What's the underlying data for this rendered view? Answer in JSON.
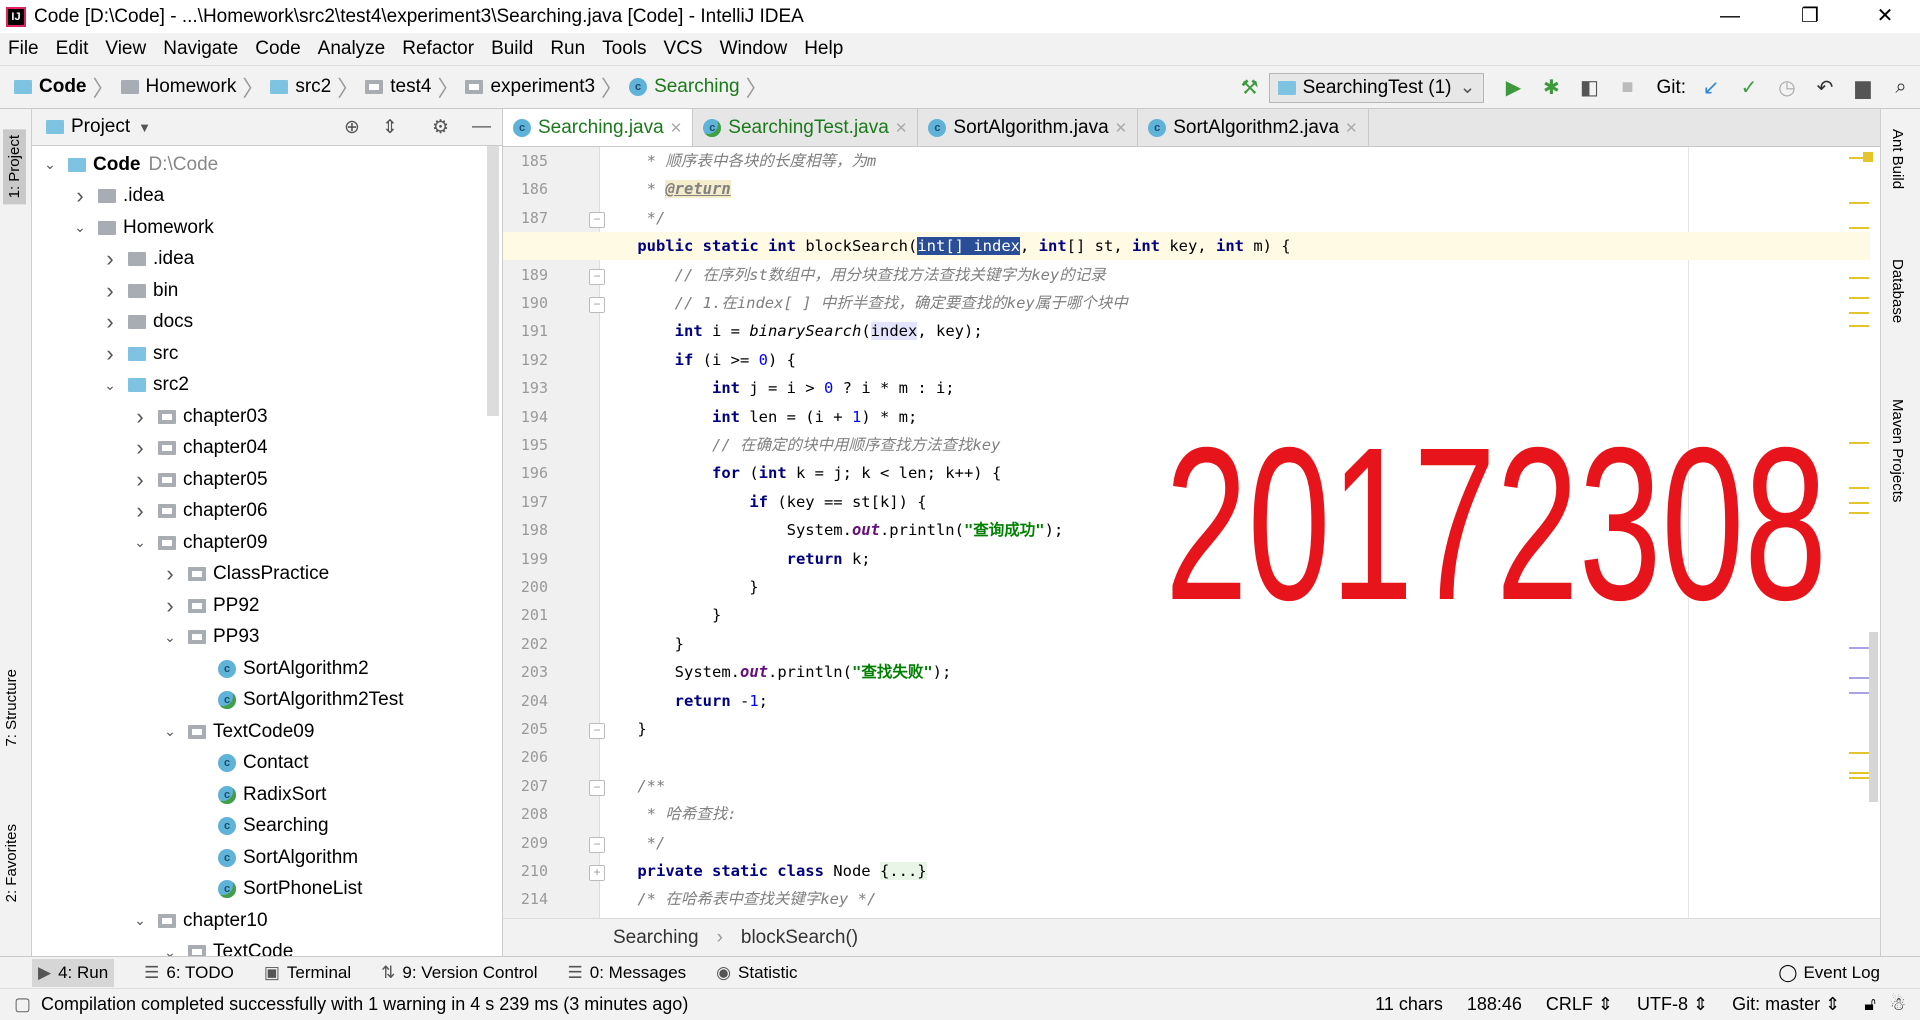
{
  "window": {
    "title": "Code [D:\\Code] - ...\\Homework\\src2\\test4\\experiment3\\Searching.java [Code] - IntelliJ IDEA",
    "minimize": "—",
    "restore": "❐",
    "close": "✕"
  },
  "menu": [
    "File",
    "Edit",
    "View",
    "Navigate",
    "Code",
    "Analyze",
    "Refactor",
    "Build",
    "Run",
    "Tools",
    "VCS",
    "Window",
    "Help"
  ],
  "breadcrumb": [
    {
      "label": "Code",
      "icon": "module-folder-icon"
    },
    {
      "label": "Homework",
      "icon": "folder-icon"
    },
    {
      "label": "src2",
      "icon": "source-folder-icon"
    },
    {
      "label": "test4",
      "icon": "package-icon"
    },
    {
      "label": "experiment3",
      "icon": "package-icon"
    },
    {
      "label": "Searching",
      "icon": "class-icon"
    }
  ],
  "toolbar": {
    "run_config": "SearchingTest (1)",
    "git_label": "Git:"
  },
  "left_stripe": {
    "project": "1: Project",
    "structure": "7: Structure",
    "favorites": "2: Favorites"
  },
  "right_stripe": {
    "ant": "Ant Build",
    "database": "Database",
    "maven": "Maven Projects"
  },
  "project": {
    "title": "Project",
    "tree": [
      {
        "label": "Code",
        "extra": "D:\\Code",
        "level": 0,
        "arrow": "open",
        "icon": "module",
        "bold": true
      },
      {
        "label": ".idea",
        "level": 1,
        "arrow": "closed",
        "icon": "folder"
      },
      {
        "label": "Homework",
        "level": 1,
        "arrow": "open",
        "icon": "folder"
      },
      {
        "label": ".idea",
        "level": 2,
        "arrow": "closed",
        "icon": "folder"
      },
      {
        "label": "bin",
        "level": 2,
        "arrow": "closed",
        "icon": "folder"
      },
      {
        "label": "docs",
        "level": 2,
        "arrow": "closed",
        "icon": "folder"
      },
      {
        "label": "src",
        "level": 2,
        "arrow": "closed",
        "icon": "srcfolder"
      },
      {
        "label": "src2",
        "level": 2,
        "arrow": "open",
        "icon": "srcfolder"
      },
      {
        "label": "chapter03",
        "level": 3,
        "arrow": "closed",
        "icon": "package"
      },
      {
        "label": "chapter04",
        "level": 3,
        "arrow": "closed",
        "icon": "package"
      },
      {
        "label": "chapter05",
        "level": 3,
        "arrow": "closed",
        "icon": "package"
      },
      {
        "label": "chapter06",
        "level": 3,
        "arrow": "closed",
        "icon": "package"
      },
      {
        "label": "chapter09",
        "level": 3,
        "arrow": "open",
        "icon": "package"
      },
      {
        "label": "ClassPractice",
        "level": 4,
        "arrow": "closed",
        "icon": "package"
      },
      {
        "label": "PP92",
        "level": 4,
        "arrow": "closed",
        "icon": "package"
      },
      {
        "label": "PP93",
        "level": 4,
        "arrow": "open",
        "icon": "package"
      },
      {
        "label": "SortAlgorithm2",
        "level": 5,
        "icon": "class"
      },
      {
        "label": "SortAlgorithm2Test",
        "level": 5,
        "icon": "testclass"
      },
      {
        "label": "TextCode09",
        "level": 4,
        "arrow": "open",
        "icon": "package"
      },
      {
        "label": "Contact",
        "level": 5,
        "icon": "class"
      },
      {
        "label": "RadixSort",
        "level": 5,
        "icon": "testclass"
      },
      {
        "label": "Searching",
        "level": 5,
        "icon": "class"
      },
      {
        "label": "SortAlgorithm",
        "level": 5,
        "icon": "class"
      },
      {
        "label": "SortPhoneList",
        "level": 5,
        "icon": "testclass"
      },
      {
        "label": "chapter10",
        "level": 3,
        "arrow": "open",
        "icon": "package"
      },
      {
        "label": "TextCode",
        "level": 4,
        "arrow": "open",
        "icon": "package"
      }
    ]
  },
  "tabs": [
    {
      "label": "Searching.java",
      "active": true,
      "icon": "class"
    },
    {
      "label": "SearchingTest.java",
      "icon": "testclass"
    },
    {
      "label": "SortAlgorithm.java",
      "icon": "class"
    },
    {
      "label": "SortAlgorithm2.java",
      "icon": "class"
    }
  ],
  "code": [
    {
      "n": "185",
      "s": [
        [
          "     * 顺序表中各块的长度相等，为m",
          "cm"
        ]
      ]
    },
    {
      "n": "186",
      "s": [
        [
          "     * ",
          "cm"
        ],
        [
          "@return",
          "tag"
        ]
      ]
    },
    {
      "n": "187",
      "fold": "-",
      "s": [
        [
          "     */",
          "cm"
        ]
      ]
    },
    {
      "n": "188",
      "fold": "-",
      "cur": true,
      "s": [
        [
          "    "
        ],
        [
          "public",
          "kw"
        ],
        [
          " "
        ],
        [
          "static int",
          "kw"
        ],
        [
          " blockSearch("
        ],
        [
          "int[] index",
          "sel"
        ],
        [
          ", "
        ],
        [
          "int",
          "kw"
        ],
        [
          "[] st, "
        ],
        [
          "int",
          "kw"
        ],
        [
          " key, "
        ],
        [
          "int",
          "kw"
        ],
        [
          " m) {"
        ]
      ]
    },
    {
      "n": "189",
      "fold": "-",
      "s": [
        [
          "        // 在序列st数组中，用分块查找方法查找关键字为key的记录",
          "cm"
        ]
      ]
    },
    {
      "n": "190",
      "fold": "-",
      "s": [
        [
          "        // 1.在index[ ] 中折半查找，确定要查找的key属于哪个块中",
          "cm"
        ]
      ]
    },
    {
      "n": "191",
      "s": [
        [
          "        "
        ],
        [
          "int",
          "kw"
        ],
        [
          " i = "
        ],
        [
          "binarySearch",
          "it"
        ],
        [
          "("
        ],
        [
          "index",
          "hl"
        ],
        [
          ", key);"
        ]
      ]
    },
    {
      "n": "192",
      "s": [
        [
          "        "
        ],
        [
          "if",
          "kw"
        ],
        [
          " (i >= "
        ],
        [
          "0",
          "num"
        ],
        [
          ") {"
        ]
      ]
    },
    {
      "n": "193",
      "s": [
        [
          "            "
        ],
        [
          "int",
          "kw"
        ],
        [
          " j = i > "
        ],
        [
          "0",
          "num"
        ],
        [
          " ? i * m : i;"
        ]
      ]
    },
    {
      "n": "194",
      "s": [
        [
          "            "
        ],
        [
          "int",
          "kw"
        ],
        [
          " len = (i + "
        ],
        [
          "1",
          "num"
        ],
        [
          ") * m;"
        ]
      ]
    },
    {
      "n": "195",
      "s": [
        [
          "            // 在确定的块中用顺序查找方法查找key",
          "cm"
        ]
      ]
    },
    {
      "n": "196",
      "s": [
        [
          "            "
        ],
        [
          "for",
          "kw"
        ],
        [
          " ("
        ],
        [
          "int",
          "kw"
        ],
        [
          " k = j; k < len; k++) {"
        ]
      ]
    },
    {
      "n": "197",
      "s": [
        [
          "                "
        ],
        [
          "if",
          "kw"
        ],
        [
          " (key == st[k]) {"
        ]
      ]
    },
    {
      "n": "198",
      "s": [
        [
          "                    System."
        ],
        [
          "out",
          "fld"
        ],
        [
          ".println("
        ],
        [
          "\"查询成功\"",
          "st"
        ],
        [
          ");"
        ]
      ]
    },
    {
      "n": "199",
      "s": [
        [
          "                    "
        ],
        [
          "return",
          "kw"
        ],
        [
          " k;"
        ]
      ]
    },
    {
      "n": "200",
      "s": [
        [
          "                }"
        ]
      ]
    },
    {
      "n": "201",
      "s": [
        [
          "            }"
        ]
      ]
    },
    {
      "n": "202",
      "s": [
        [
          "        }"
        ]
      ]
    },
    {
      "n": "203",
      "s": [
        [
          "        System."
        ],
        [
          "out",
          "fld"
        ],
        [
          ".println("
        ],
        [
          "\"查找失败\"",
          "st"
        ],
        [
          ");"
        ]
      ]
    },
    {
      "n": "204",
      "s": [
        [
          "        "
        ],
        [
          "return",
          "kw"
        ],
        [
          " -"
        ],
        [
          "1",
          "num"
        ],
        [
          ";"
        ]
      ]
    },
    {
      "n": "205",
      "fold": "-",
      "s": [
        [
          "    }"
        ]
      ]
    },
    {
      "n": "206",
      "s": [
        [
          ""
        ]
      ]
    },
    {
      "n": "207",
      "fold": "-",
      "s": [
        [
          "    /**",
          "cm"
        ]
      ]
    },
    {
      "n": "208",
      "s": [
        [
          "     * 哈希查找:",
          "cm"
        ]
      ]
    },
    {
      "n": "209",
      "fold": "-",
      "s": [
        [
          "     */",
          "cm"
        ]
      ]
    },
    {
      "n": "210",
      "fold": "+",
      "s": [
        [
          "    "
        ],
        [
          "private static class",
          "kw"
        ],
        [
          " Node "
        ],
        [
          "{...}",
          "fold-ph"
        ]
      ]
    },
    {
      "n": "214",
      "s": [
        [
          "    /* 在哈希表中查找关键字key */",
          "cm"
        ]
      ]
    }
  ],
  "watermark": "20172308",
  "editor_breadcrumb": {
    "class": "Searching",
    "method": "blockSearch()"
  },
  "tool_windows": [
    {
      "label": "4: Run",
      "icon": "run-icon"
    },
    {
      "label": "6: TODO",
      "icon": "todo-icon"
    },
    {
      "label": "Terminal",
      "icon": "terminal-icon"
    },
    {
      "label": "9: Version Control",
      "icon": "vcs-icon"
    },
    {
      "label": "0: Messages",
      "icon": "messages-icon"
    },
    {
      "label": "Statistic",
      "icon": "statistic-icon"
    }
  ],
  "event_log": "Event Log",
  "status": {
    "message": "Compilation completed successfully with 1 warning in 4 s 239 ms (3 minutes ago)",
    "chars": "11 chars",
    "position": "188:46",
    "line_sep": "CRLF ⇕",
    "encoding": "UTF-8 ⇕",
    "git": "Git: master ⇕"
  },
  "colors": {
    "keyword": "#000080",
    "comment": "#808080",
    "string": "#008000",
    "selection": "#2a4d97",
    "watermark": "#e8141c"
  }
}
